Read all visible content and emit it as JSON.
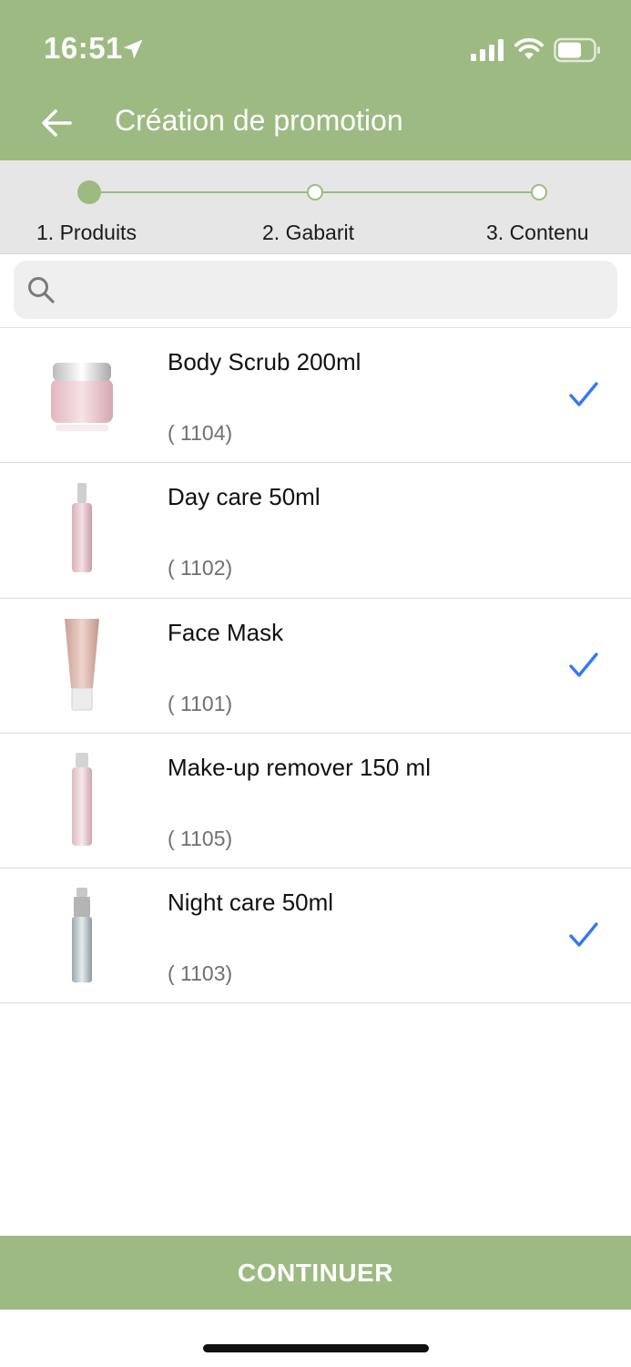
{
  "status_bar": {
    "time": "16:51",
    "icons": [
      "location-arrow-icon",
      "signal-icon",
      "wifi-icon",
      "battery-icon"
    ]
  },
  "header": {
    "back_icon": "back-arrow-icon",
    "title": "Création de promotion"
  },
  "stepper": {
    "steps": [
      {
        "label": "1. Produits",
        "state": "active"
      },
      {
        "label": "2. Gabarit",
        "state": "inactive"
      },
      {
        "label": "3. Contenu",
        "state": "inactive"
      }
    ]
  },
  "search": {
    "icon": "search-icon",
    "value": "",
    "placeholder": ""
  },
  "products": [
    {
      "name": "Body Scrub 200ml",
      "code": "( 1104)",
      "selected": true,
      "image": "jar"
    },
    {
      "name": "Day care 50ml",
      "code": "( 1102)",
      "selected": false,
      "image": "slim-bottle"
    },
    {
      "name": "Face Mask",
      "code": "( 1101)",
      "selected": true,
      "image": "tube"
    },
    {
      "name": "Make-up remover 150 ml",
      "code": "( 1105)",
      "selected": false,
      "image": "tall-bottle"
    },
    {
      "name": "Night care 50ml",
      "code": "( 1103)",
      "selected": true,
      "image": "pump-bottle"
    }
  ],
  "footer": {
    "continue_label": "CONTINUER"
  },
  "colors": {
    "accent": "#9dba82",
    "check": "#3478f6",
    "stepper_bg": "#e6e6e6"
  }
}
